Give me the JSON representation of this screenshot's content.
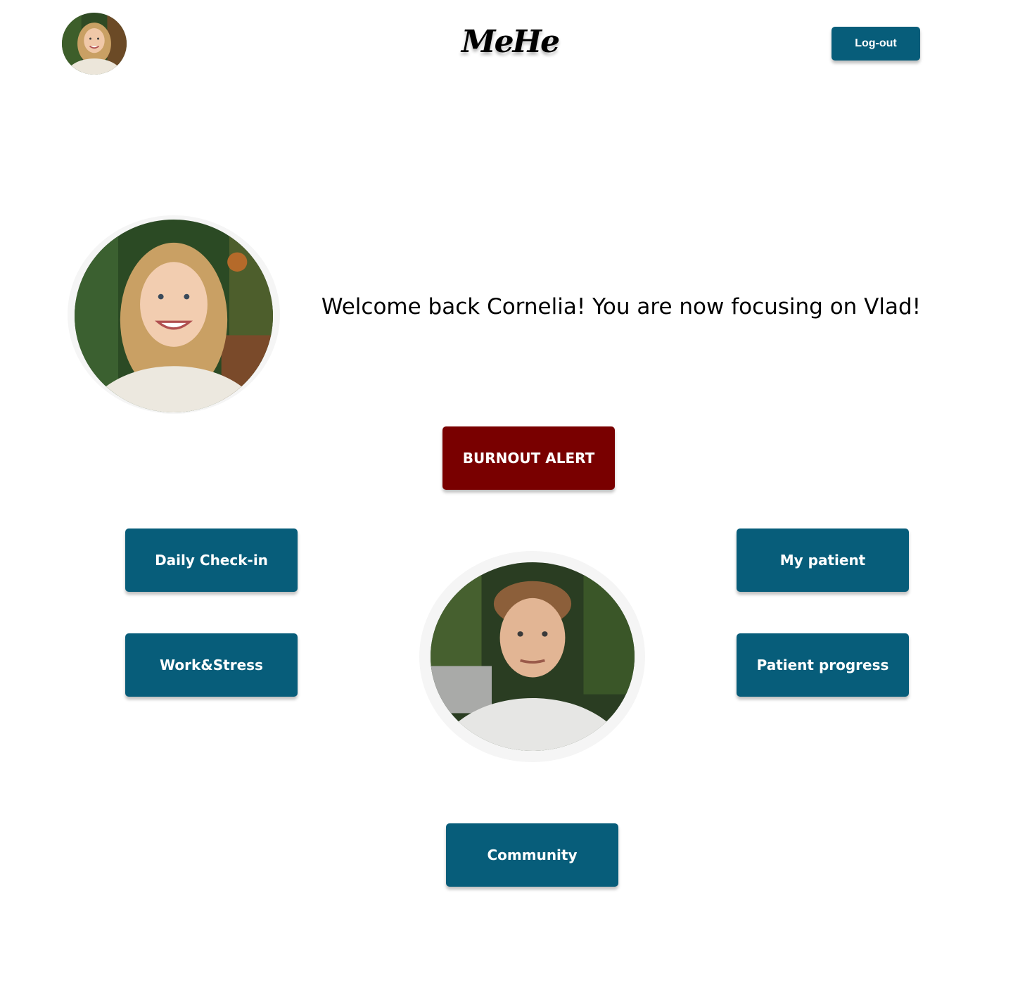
{
  "header": {
    "logo": "MeHe",
    "logout_label": "Log-out"
  },
  "welcome": {
    "message": "Welcome back Cornelia! You are now focusing on Vlad!"
  },
  "actions": {
    "burnout_alert": "BURNOUT ALERT",
    "daily_checkin": "Daily Check-in",
    "work_stress": "Work&Stress",
    "my_patient": "My patient",
    "patient_progress": "Patient progress",
    "community": "Community"
  },
  "colors": {
    "primary": "#075d7a",
    "alert": "#790000",
    "avatar_ring": "#f5f5f5"
  }
}
